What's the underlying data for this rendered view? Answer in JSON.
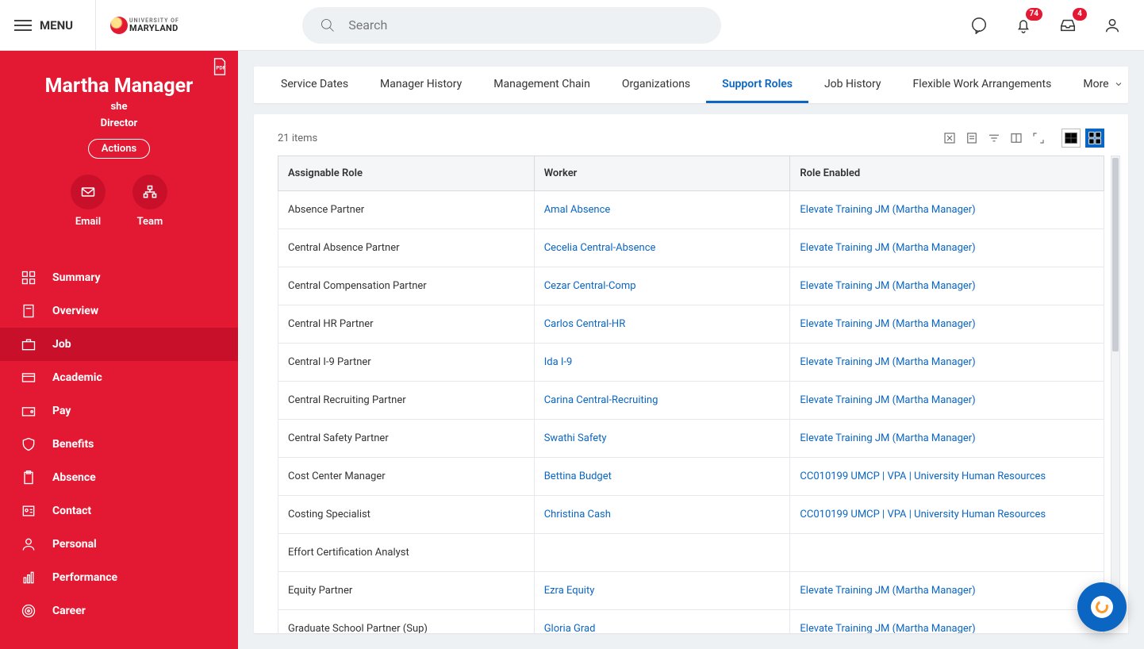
{
  "header": {
    "menu_label": "MENU",
    "logo_top": "UNIVERSITY OF",
    "logo_main": "MARYLAND",
    "search_placeholder": "Search",
    "badge_notifications": "74",
    "badge_inbox": "4"
  },
  "profile": {
    "name": "Martha Manager",
    "pronoun": "she",
    "title": "Director",
    "actions_label": "Actions",
    "email_label": "Email",
    "team_label": "Team"
  },
  "nav": {
    "items": [
      {
        "label": "Summary"
      },
      {
        "label": "Overview"
      },
      {
        "label": "Job"
      },
      {
        "label": "Academic"
      },
      {
        "label": "Pay"
      },
      {
        "label": "Benefits"
      },
      {
        "label": "Absence"
      },
      {
        "label": "Contact"
      },
      {
        "label": "Personal"
      },
      {
        "label": "Performance"
      },
      {
        "label": "Career"
      }
    ],
    "active_index": 2
  },
  "tabs": {
    "items": [
      "Service Dates",
      "Manager History",
      "Management Chain",
      "Organizations",
      "Support Roles",
      "Job History",
      "Flexible Work Arrangements"
    ],
    "more_label": "More",
    "active_index": 4
  },
  "table": {
    "count_label": "21 items",
    "columns": [
      "Assignable Role",
      "Worker",
      "Role Enabled"
    ],
    "rows": [
      {
        "role": "Absence Partner",
        "worker": "Amal Absence",
        "enabled": "Elevate Training JM (Martha Manager)"
      },
      {
        "role": "Central Absence Partner",
        "worker": "Cecelia Central-Absence",
        "enabled": "Elevate Training JM (Martha Manager)"
      },
      {
        "role": "Central Compensation Partner",
        "worker": "Cezar Central-Comp",
        "enabled": "Elevate Training JM (Martha Manager)"
      },
      {
        "role": "Central HR Partner",
        "worker": "Carlos Central-HR",
        "enabled": "Elevate Training JM (Martha Manager)"
      },
      {
        "role": "Central I-9 Partner",
        "worker": "Ida I-9",
        "enabled": "Elevate Training JM (Martha Manager)"
      },
      {
        "role": "Central Recruiting Partner",
        "worker": "Carina Central-Recruiting",
        "enabled": "Elevate Training JM (Martha Manager)"
      },
      {
        "role": "Central Safety Partner",
        "worker": "Swathi Safety",
        "enabled": "Elevate Training JM (Martha Manager)"
      },
      {
        "role": "Cost Center Manager",
        "worker": "Bettina Budget",
        "enabled": "CC010199 UMCP | VPA | University Human Resources"
      },
      {
        "role": "Costing Specialist",
        "worker": "Christina Cash",
        "enabled": "CC010199 UMCP | VPA | University Human Resources"
      },
      {
        "role": "Effort Certification Analyst",
        "worker": "",
        "enabled": ""
      },
      {
        "role": "Equity Partner",
        "worker": "Ezra Equity",
        "enabled": "Elevate Training JM (Martha Manager)"
      },
      {
        "role": "Graduate School Partner (Sup)",
        "worker": "Gloria Grad",
        "enabled": "Elevate Training JM (Martha Manager)"
      }
    ]
  }
}
